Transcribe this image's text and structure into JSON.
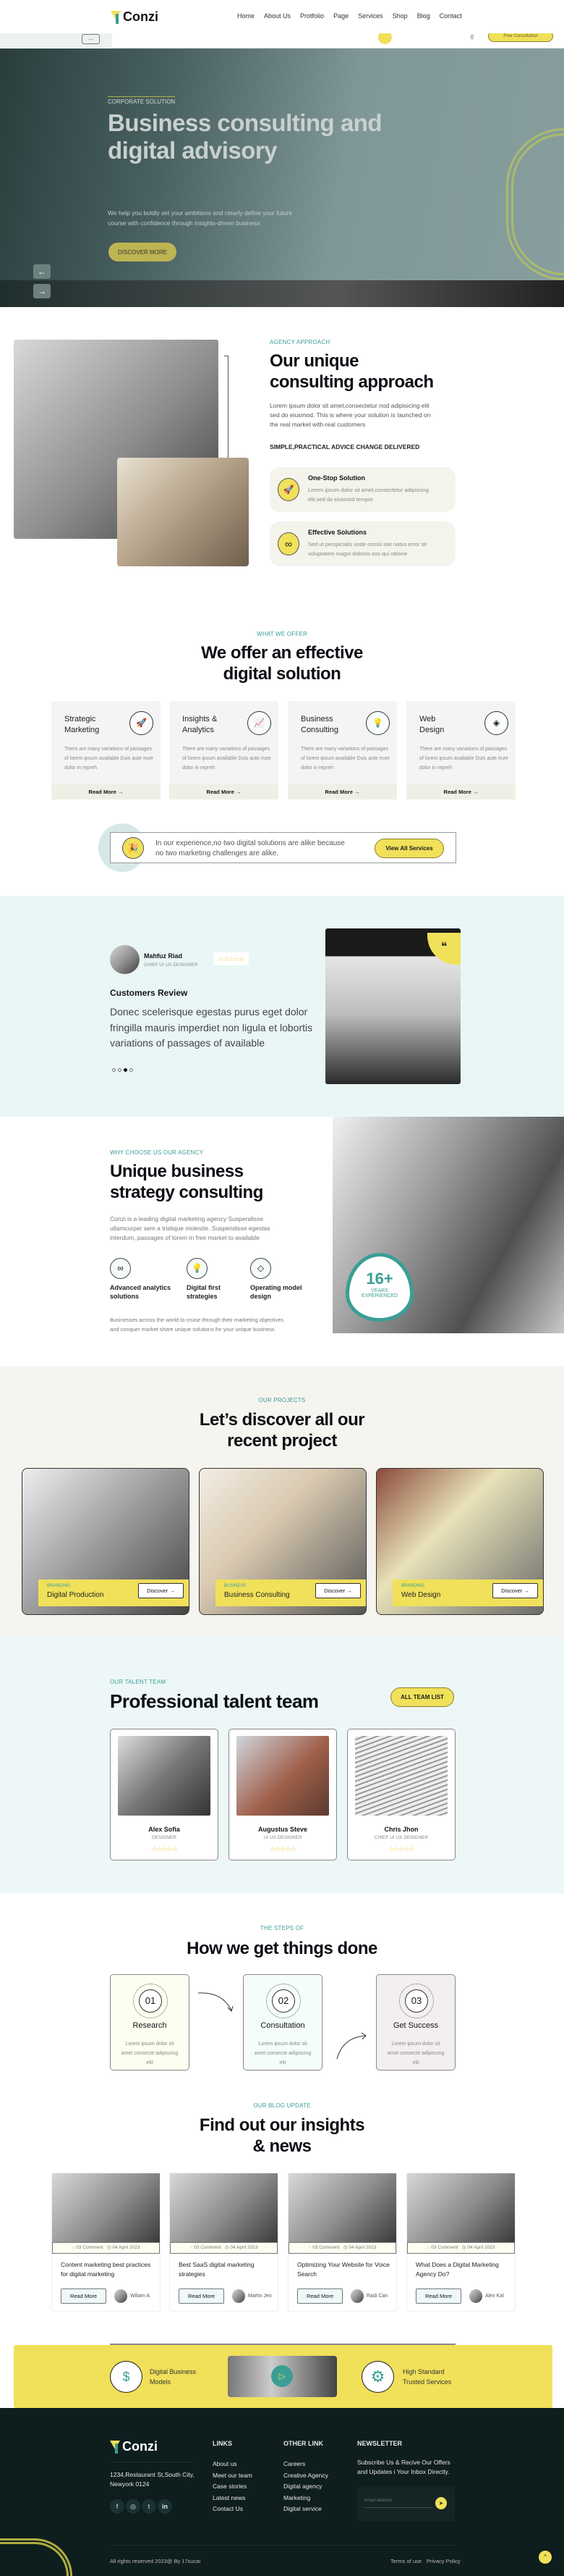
{
  "brand": {
    "name": "Conzi"
  },
  "nav": [
    "Home",
    "About Us",
    "Protfolio",
    "Page",
    "Services",
    "Shop",
    "Blog",
    "Contact"
  ],
  "header": {
    "cta": "Free Consultation",
    "menu_dots": "..."
  },
  "hero": {
    "label": "CORPORATE SOLUTION",
    "title1": "Business consulting and",
    "title2": "digital advisory",
    "text1": "We help you boldly set your ambitions and clearly define your future",
    "text2": "course with confidence through insights-driven business",
    "button": "DISCOVER MORE"
  },
  "approach": {
    "label": "AGENCY APPROACH",
    "title1": "Our unique",
    "title2": "consulting approach",
    "text": "Lorem ipsum dolor sit amet,consectetur nod adipisicing elit sed do eiusmod. This is where your solution is launched on the real market with real customers",
    "subheading": "SIMPLE,PRACTICAL ADVICE CHANGE DELIVERED",
    "features": [
      {
        "title": "One-Stop Solution",
        "text": "Lorem ipsum dolor sit amet,consectetur adipiscing elit,sed do eiusmod tempor",
        "icon": "rocket-icon"
      },
      {
        "title": "Effective Solutions",
        "text": "Sed ut perspiciatis unde omnis iste natus error sit voluptatem magni dolores eos qui ratione",
        "icon": "infinity-icon"
      }
    ]
  },
  "offer": {
    "label": "WHAT WE OFFER",
    "title1": "We offer an effective",
    "title2": "digital solution",
    "services": [
      {
        "t1": "Strategic",
        "t2": "Marketing",
        "text": "There are many variations of passages of lorem ipsum available Duis aute irure dolor in repreh",
        "link": "Read More",
        "icon": "rocket-icon"
      },
      {
        "t1": "Insights &",
        "t2": "Analytics",
        "text": "There are many variations of passages of lorem ipsum available Duis aute irure dolor in repreh",
        "link": "Read More",
        "icon": "chart-icon"
      },
      {
        "t1": "Business",
        "t2": "Consulting",
        "text": "There are many variations of passages of lorem ipsum available Duis aute irure dolor in repreh",
        "link": "Read More",
        "icon": "lightbulb-icon"
      },
      {
        "t1": "Web",
        "t2": "Design",
        "text": "There are many variations of passages of lorem ipsum available Duis aute irure dolor in repreh",
        "link": "Read More",
        "icon": "layers-icon"
      }
    ],
    "banner": {
      "text1": "In our experience,no two digital solutions are alike because",
      "text2": "no two marketing challenges are alike.",
      "button": "View All Services"
    }
  },
  "testimonial": {
    "name": "Mahfuz Riad",
    "role": "CHIEF UI UX DESIGNER",
    "rating": 5,
    "heading": "Customers Review",
    "quote": "Donec scelerisque egestas purus eget dolor fringilla mauris imperdiet non ligula et lobortis variations of passages of available",
    "slides": 4,
    "active_slide": 3
  },
  "why": {
    "label": "WHY CHOOSE US OUR AGENCY",
    "title1": "Unique business",
    "title2": "strategy consulting",
    "text": "Conzi is a leading digital marketing agency Suspendisse ullamcorper sem a tristique molestie. Suspendisse egestas interdum, passages of lorem in free market to available",
    "features": [
      {
        "l1": "Advanced analytics",
        "l2": "solutions",
        "icon": "infinity-icon"
      },
      {
        "l1": "Digital first",
        "l2": "strategies",
        "icon": "lightbulb-icon"
      },
      {
        "l1": "Operating model",
        "l2": "design",
        "icon": "diamond-icon"
      }
    ],
    "footer_text": "Businesses across the world to cruise through their marketing objectives and conquer market share unique solutions for your unique business",
    "badge": {
      "value": "16+",
      "l1": "YEARS",
      "l2": "EXPERIENCED"
    }
  },
  "projects": {
    "label": "OUR PROJECTS",
    "title1": "Let’s discover all our",
    "title2": "recent project",
    "items": [
      {
        "cat": "BRANDING",
        "title": "Digital Production",
        "button": "Discover"
      },
      {
        "cat": "BUSINESS",
        "title": "Business Consulting",
        "button": "Discover"
      },
      {
        "cat": "BRANDING",
        "title": "Web Design",
        "button": "Discover"
      }
    ]
  },
  "team": {
    "label": "OUR TALENT TEAM",
    "title": "Professional talent team",
    "button": "ALL TEAM LIST",
    "members": [
      {
        "name": "Alex Sofia",
        "role": "DESIGNER",
        "rating": 5
      },
      {
        "name": "Augustus Steve",
        "role": "UI UX DESIGNER",
        "rating": 5
      },
      {
        "name": "Chris Jhon",
        "role": "CHIEF UI UX DESIGNER",
        "rating": 5
      }
    ]
  },
  "steps": {
    "label": "THE STEPS OF",
    "title": "How we get things done",
    "items": [
      {
        "num": "01",
        "title": "Research",
        "text": "Lorem ipsum dolor sit amet consecte adipiscing elit"
      },
      {
        "num": "02",
        "title": "Consultation",
        "text": "Lorem ipsum dolor sit amet consecte adipiscing elit"
      },
      {
        "num": "03",
        "title": "Get Success",
        "text": "Lorem ipsum dolor sit amet consecte adipiscing elit"
      }
    ]
  },
  "blog": {
    "label": "OUR BLOG UPDATE",
    "title1": "Find out our insights",
    "title2": "& news",
    "posts": [
      {
        "comments": "03 Comment",
        "date": "04 April 2023",
        "title": "Content marketing best practices for digital marketing",
        "button": "Read More",
        "author": "Wiliam A"
      },
      {
        "comments": "03 Comment",
        "date": "04 April 2023",
        "title": "Best SaaS digital marketing strategies",
        "button": "Read More",
        "author": "Martin Jeo"
      },
      {
        "comments": "03 Comment",
        "date": "04 April 2023",
        "title": "Optimizing Your Website for Voice Search",
        "button": "Read More",
        "author": "Radi Can"
      },
      {
        "comments": "03 Comment",
        "date": "04 April 2023",
        "title": "What Does a Digital Marketing Agency Do?",
        "button": "Read More",
        "author": "Alex Kal"
      }
    ]
  },
  "band": {
    "left1": "Digital Business",
    "left2": "Models",
    "right1": "High Standard",
    "right2": "Trusted Services"
  },
  "footer": {
    "address": "1234,Restaurant St,South City, Newyork 0124",
    "links_title": "LINKS",
    "links": [
      "About us",
      "Meet our team",
      "Case stories",
      "Latest news",
      "Contact Us"
    ],
    "other_title": "OTHER LINK",
    "other": [
      "Careers",
      "Creative Agency",
      "Digital agency",
      "Marketing",
      "Digital service"
    ],
    "news_title": "NEWSLETTER",
    "news_text": "Subscribe Us & Recive Our Offers and Updates i Your Inbox Directly.",
    "email_placeholder": "Email address",
    "copyright": "All rights reserved 2023@ By 17sucai",
    "terms": "Terms of use",
    "privacy": "Privacy Policy"
  },
  "colors": {
    "accent": "#f0e05a",
    "teal": "#3a9e95",
    "footer": "#0e1d1d",
    "mint": "#eaf6f6",
    "cream": "#f5f4ee"
  }
}
